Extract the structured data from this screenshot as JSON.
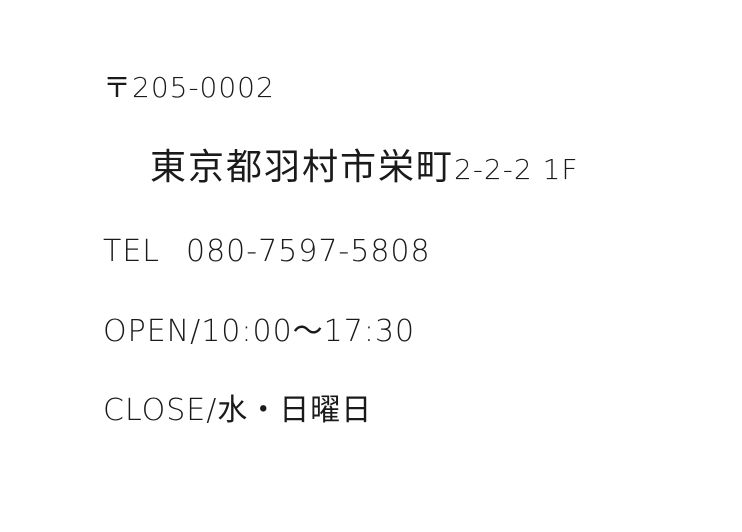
{
  "info": {
    "postal": "〒205-0002",
    "address_kanji": "東京都羽村市栄町",
    "address_number": "2-2-2 1F",
    "tel_label": "TEL",
    "tel_number": "080-7597-5808",
    "open_hours": "OPEN/10:00～17:30",
    "close_days": "CLOSE/水・日曜日"
  }
}
